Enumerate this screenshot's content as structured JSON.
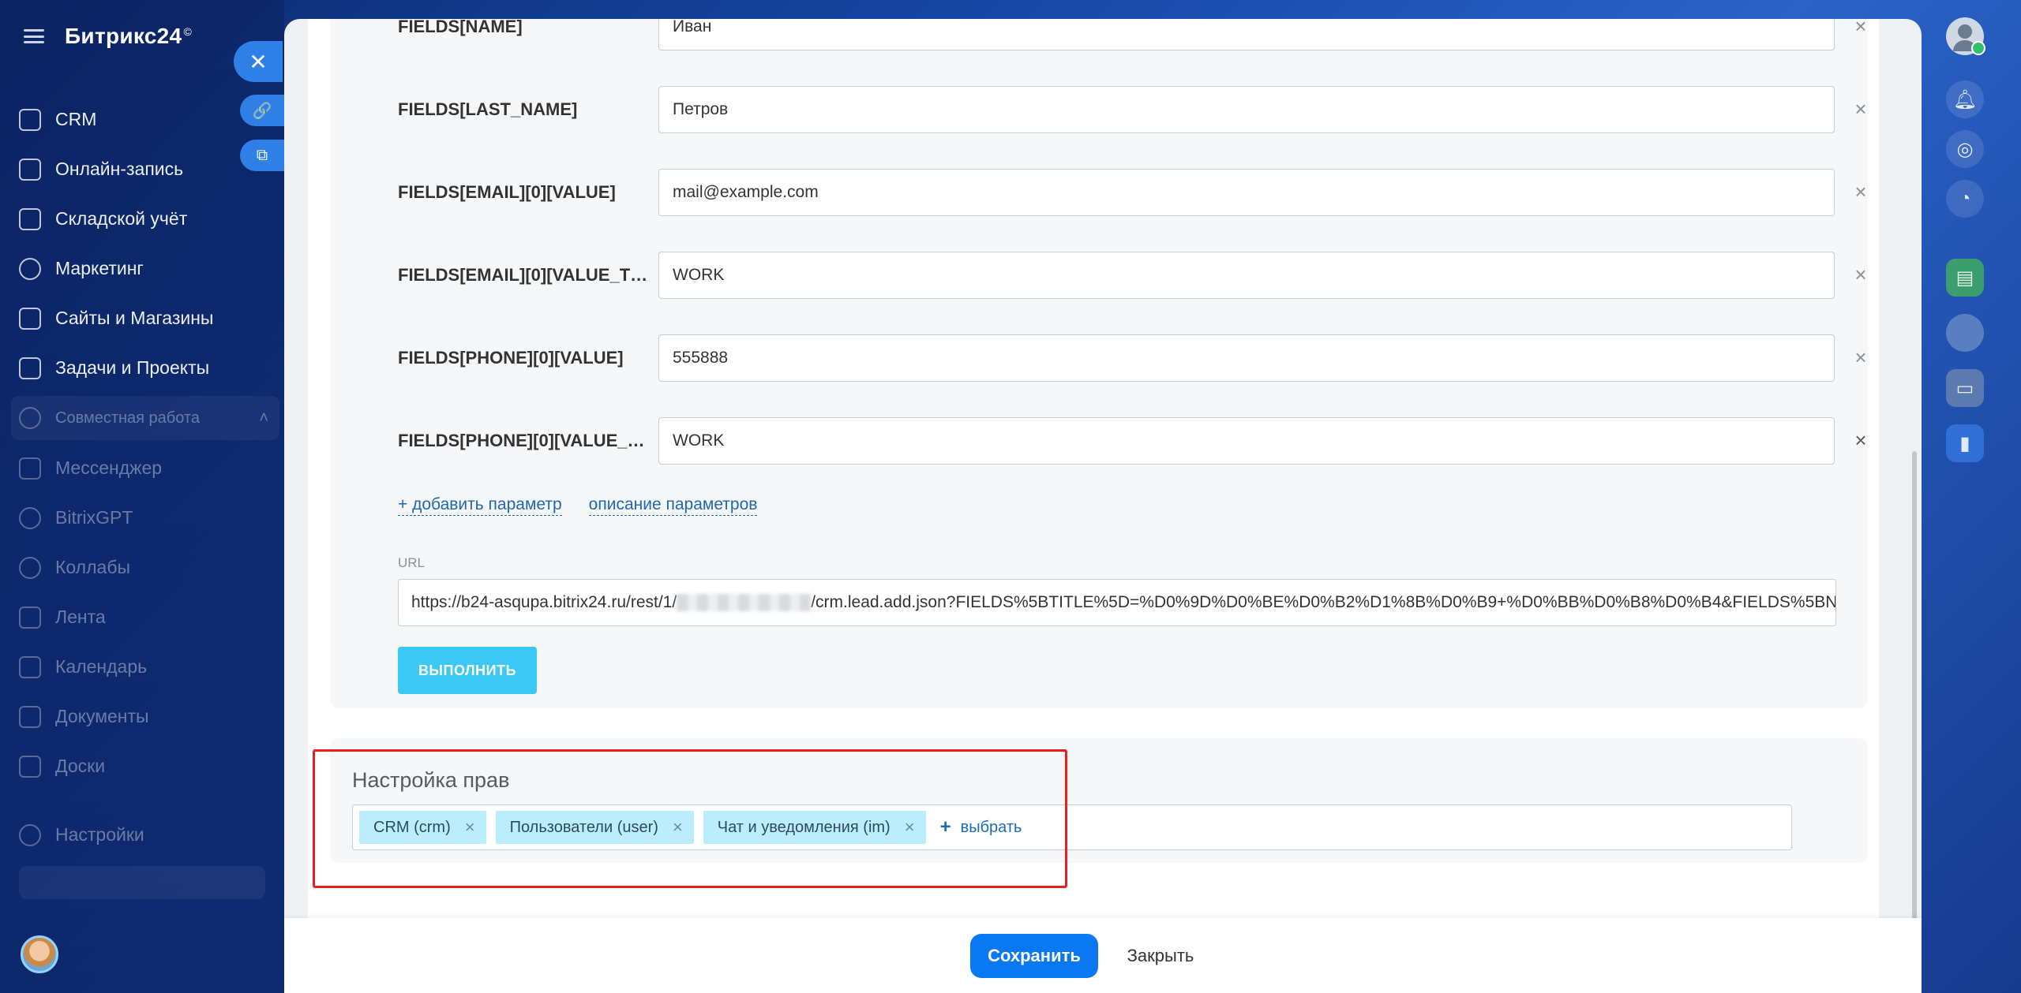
{
  "sidebar": {
    "brand": "Битрикс24",
    "brand_mark": "©",
    "items": [
      {
        "label": "CRM",
        "icon": "crm-funnel-icon"
      },
      {
        "label": "Онлайн-запись",
        "icon": "calendar-booking-icon"
      },
      {
        "label": "Складской учёт",
        "icon": "warehouse-icon"
      },
      {
        "label": "Маркетинг",
        "icon": "target-icon"
      },
      {
        "label": "Сайты и Магазины",
        "icon": "cart-icon"
      },
      {
        "label": "Задачи и Проекты",
        "icon": "checkbox-icon"
      }
    ],
    "group_label": "Совместная работа",
    "group_items": [
      {
        "label": "Мессенджер"
      },
      {
        "label": "BitrixGPT"
      },
      {
        "label": "Коллабы"
      },
      {
        "label": "Лента"
      },
      {
        "label": "Календарь"
      },
      {
        "label": "Документы"
      },
      {
        "label": "Доски"
      }
    ],
    "settings_label": "Настройки"
  },
  "form": {
    "fields": [
      {
        "name": "FIELDS[NAME]",
        "value": "Иван"
      },
      {
        "name": "FIELDS[LAST_NAME]",
        "value": "Петров"
      },
      {
        "name": "FIELDS[EMAIL][0][VALUE]",
        "value": "mail@example.com"
      },
      {
        "name": "FIELDS[EMAIL][0][VALUE_TY...",
        "value": "WORK"
      },
      {
        "name": "FIELDS[PHONE][0][VALUE]",
        "value": "555888"
      },
      {
        "name": "FIELDS[PHONE][0][VALUE_TY...",
        "value": "WORK"
      }
    ],
    "add_param_label": "+ добавить параметр",
    "params_desc_label": "описание параметров",
    "url_label": "URL",
    "url_prefix": "https://b24-asqupa.bitrix24.ru/rest/1/",
    "url_suffix": "/crm.lead.add.json?FIELDS%5BTITLE%5D=%D0%9D%D0%BE%D0%B2%D1%8B%D0%B9+%D0%BB%D0%B8%D0%B4&FIELDS%5BN...",
    "run_label": "ВЫПОЛНИТЬ"
  },
  "rights": {
    "title": "Настройка прав",
    "tags": [
      {
        "label": "CRM (crm)"
      },
      {
        "label": "Пользователи (user)"
      },
      {
        "label": "Чат и уведомления (im)"
      }
    ],
    "choose_label": "выбрать"
  },
  "footer": {
    "save_label": "Сохранить",
    "close_label": "Закрыть"
  },
  "colors": {
    "accent": "#0a78f2",
    "run_button": "#3bc8f5",
    "tag_bg": "#bcedfc",
    "highlight": "#e52222"
  }
}
